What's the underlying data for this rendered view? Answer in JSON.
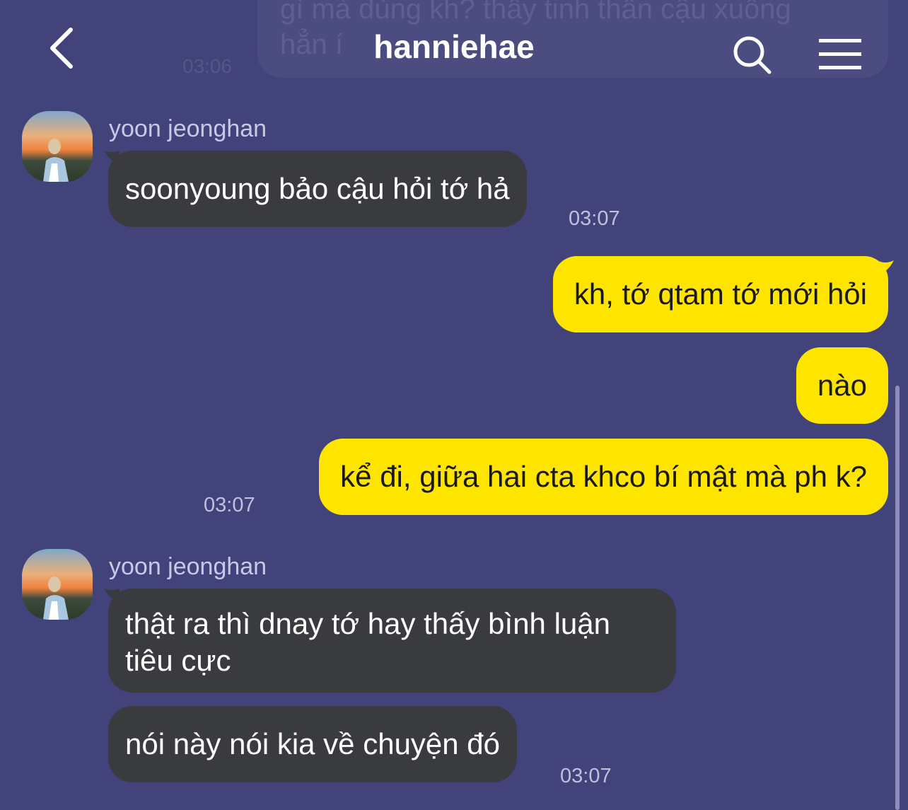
{
  "header": {
    "title": "hanniehae"
  },
  "previous_message": {
    "line1": "gì mà dùng kh? thấy tinh thần cậu xuống",
    "line2": "hẳn í",
    "time": "03:06"
  },
  "groups": [
    {
      "sender": "yoon jeonghan",
      "messages": [
        "soonyoung bảo cậu hỏi tớ hả"
      ],
      "time": "03:07"
    },
    {
      "sender": "me",
      "messages": [
        "kh, tớ qtam tớ mới hỏi",
        "nào",
        "kể đi, giữa hai cta khco bí mật mà ph k?"
      ],
      "time": "03:07"
    },
    {
      "sender": "yoon jeonghan",
      "messages": [
        "thật ra thì dnay tớ hay thấy bình luận tiêu cực",
        "nói này nói kia về chuyện đó"
      ],
      "time": "03:07"
    }
  ],
  "colors": {
    "background": "#41437a",
    "incoming_bubble": "#3a3b3f",
    "outgoing_bubble": "#fee500"
  },
  "icons": {
    "back": "chevron-left-icon",
    "search": "search-icon",
    "menu": "hamburger-menu-icon"
  }
}
